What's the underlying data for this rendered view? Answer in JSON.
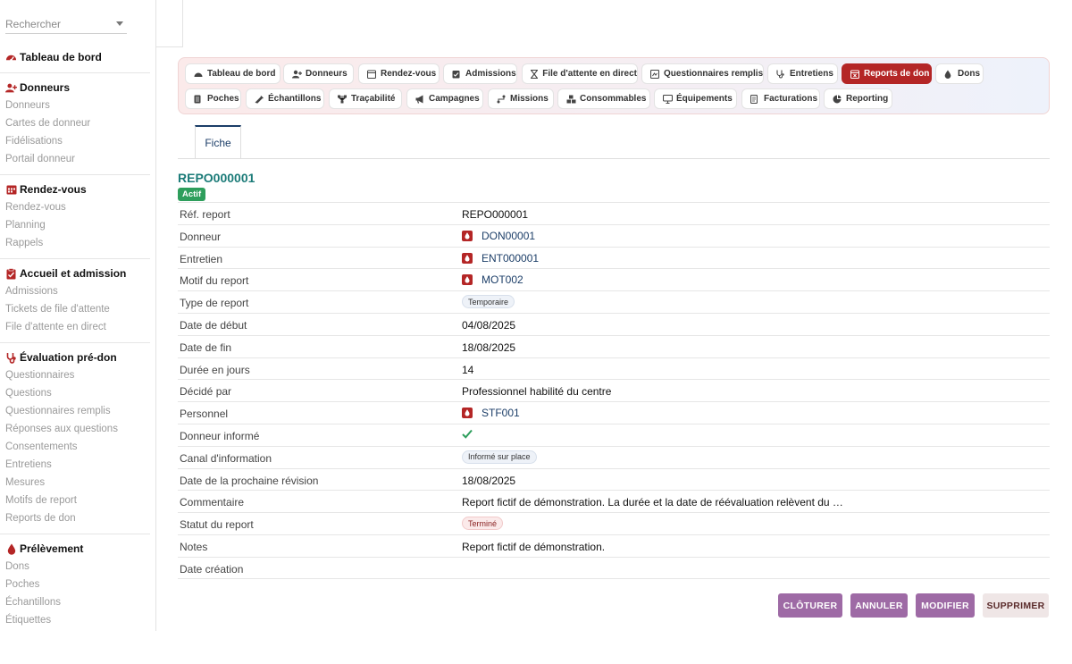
{
  "search": {
    "placeholder": "Rechercher"
  },
  "sidebar": {
    "groups": [
      {
        "title": "Tableau de bord",
        "icon": "dashboard-icon",
        "items": []
      },
      {
        "title": "Donneurs",
        "icon": "user-plus-icon",
        "items": [
          "Donneurs",
          "Cartes de donneur",
          "Fidélisations",
          "Portail donneur"
        ]
      },
      {
        "title": "Rendez-vous",
        "icon": "calendar-icon",
        "items": [
          "Rendez-vous",
          "Planning",
          "Rappels"
        ]
      },
      {
        "title": "Accueil et admission",
        "icon": "clipboard-check-icon",
        "items": [
          "Admissions",
          "Tickets de file d'attente",
          "File d'attente en direct"
        ]
      },
      {
        "title": "Évaluation pré-don",
        "icon": "stethoscope-icon",
        "items": [
          "Questionnaires",
          "Questions",
          "Questionnaires remplis",
          "Réponses aux questions",
          "Consentements",
          "Entretiens",
          "Mesures",
          "Motifs de report",
          "Reports de don"
        ]
      },
      {
        "title": "Prélèvement",
        "icon": "blood-drop-icon",
        "items": [
          "Dons",
          "Poches",
          "Échantillons",
          "Étiquettes"
        ]
      }
    ]
  },
  "tabs": [
    {
      "label": "Tableau de bord",
      "icon": "dashboard-icon"
    },
    {
      "label": "Donneurs",
      "icon": "user-plus-icon"
    },
    {
      "label": "Rendez-vous",
      "icon": "calendar-icon"
    },
    {
      "label": "Admissions",
      "icon": "clipboard-check-icon"
    },
    {
      "label": "File d'attente en direct",
      "icon": "hourglass-icon"
    },
    {
      "label": "Questionnaires remplis",
      "icon": "form-icon"
    },
    {
      "label": "Entretiens",
      "icon": "stethoscope-icon"
    },
    {
      "label": "Reports de don",
      "icon": "calendar-x-icon",
      "active": true
    },
    {
      "label": "Dons",
      "icon": "blood-drop-icon"
    },
    {
      "label": "Poches",
      "icon": "bag-icon"
    },
    {
      "label": "Échantillons",
      "icon": "syringe-icon"
    },
    {
      "label": "Traçabilité",
      "icon": "network-icon"
    },
    {
      "label": "Campagnes",
      "icon": "megaphone-icon"
    },
    {
      "label": "Missions",
      "icon": "route-icon"
    },
    {
      "label": "Consommables",
      "icon": "boxes-icon"
    },
    {
      "label": "Équipements",
      "icon": "monitor-icon"
    },
    {
      "label": "Facturations",
      "icon": "invoice-icon"
    },
    {
      "label": "Reporting",
      "icon": "pie-chart-icon"
    }
  ],
  "content_tab": {
    "label": "Fiche"
  },
  "record": {
    "title": "REPO000001",
    "status_badge": "Actif",
    "fields": [
      {
        "label": "Réf. report",
        "value": "REPO000001",
        "kind": "text"
      },
      {
        "label": "Donneur",
        "value": "DON00001",
        "kind": "link"
      },
      {
        "label": "Entretien",
        "value": "ENT000001",
        "kind": "link"
      },
      {
        "label": "Motif du report",
        "value": "MOT002",
        "kind": "link"
      },
      {
        "label": "Type de report",
        "value": "Temporaire",
        "kind": "chip"
      },
      {
        "label": "Date de début",
        "value": "04/08/2025",
        "kind": "text"
      },
      {
        "label": "Date de fin",
        "value": "18/08/2025",
        "kind": "text"
      },
      {
        "label": "Durée en jours",
        "value": "14",
        "kind": "text"
      },
      {
        "label": "Décidé par",
        "value": "Professionnel habilité du centre",
        "kind": "text"
      },
      {
        "label": "Personnel",
        "value": "STF001",
        "kind": "link"
      },
      {
        "label": "Donneur informé",
        "value": "",
        "kind": "check"
      },
      {
        "label": "Canal d'information",
        "value": "Informé sur place",
        "kind": "chip"
      },
      {
        "label": "Date de la prochaine révision",
        "value": "18/08/2025",
        "kind": "text"
      },
      {
        "label": "Commentaire",
        "value": "Report fictif de démonstration. La durée et la date de réévaluation relèvent du …",
        "kind": "text"
      },
      {
        "label": "Statut du report",
        "value": "Terminé",
        "kind": "chip-red"
      },
      {
        "label": "Notes",
        "value": "Report fictif de démonstration.",
        "kind": "text"
      },
      {
        "label": "Date création",
        "value": "",
        "kind": "text"
      }
    ]
  },
  "actions": {
    "close_label": "CLÔTURER",
    "cancel_label": "ANNULER",
    "edit_label": "MODIFIER",
    "delete_label": "SUPPRIMER"
  },
  "colors": {
    "accent_red": "#b42626",
    "title_teal": "#1b7b78",
    "link_navy": "#1c3e68",
    "success_green": "#2e9e5c",
    "button_purple": "#9e6aa5"
  }
}
